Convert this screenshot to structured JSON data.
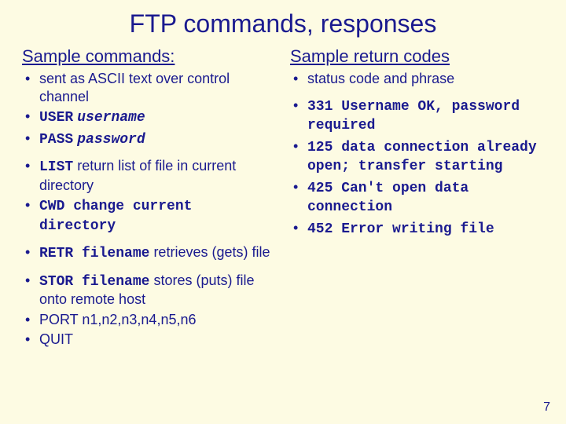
{
  "title": "FTP commands, responses",
  "left": {
    "heading": "Sample commands:",
    "items": {
      "b0": "sent as ASCII text over control channel",
      "b1_cmd": "USER",
      "b1_arg": "username",
      "b2_cmd": "PASS",
      "b2_arg": "password",
      "b3_cmd": "LIST",
      "b3_rest": " return list of file in current directory",
      "b4_cmd": "CWD",
      "b4_rest": " change current directory",
      "b5_cmd": "RETR filename",
      "b5_rest": " retrieves (gets) file",
      "b6_cmd": "STOR filename",
      "b6_rest": " stores (puts) file onto remote host",
      "b7": "PORT n1,n2,n3,n4,n5,n6",
      "b8": "QUIT"
    }
  },
  "right": {
    "heading": "Sample return codes",
    "items": {
      "r0": "status code and phrase",
      "r1": "331 Username OK, password required",
      "r2": "125 data connection already open; transfer starting",
      "r3": "425 Can't open data connection",
      "r4": "452 Error writing file"
    }
  },
  "page_number": "7"
}
